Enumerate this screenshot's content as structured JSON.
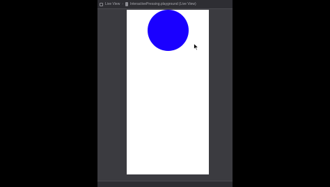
{
  "window": {
    "breadcrumb_view": "Live View",
    "breadcrumb_sep": "›",
    "breadcrumb_page": "InteractivePressing.playground (Live View)"
  },
  "canvas": {
    "background": "#ffffff"
  },
  "circle": {
    "color": "#1a00ff"
  },
  "cursor": {
    "icon": "arrow-pointer-icon"
  }
}
